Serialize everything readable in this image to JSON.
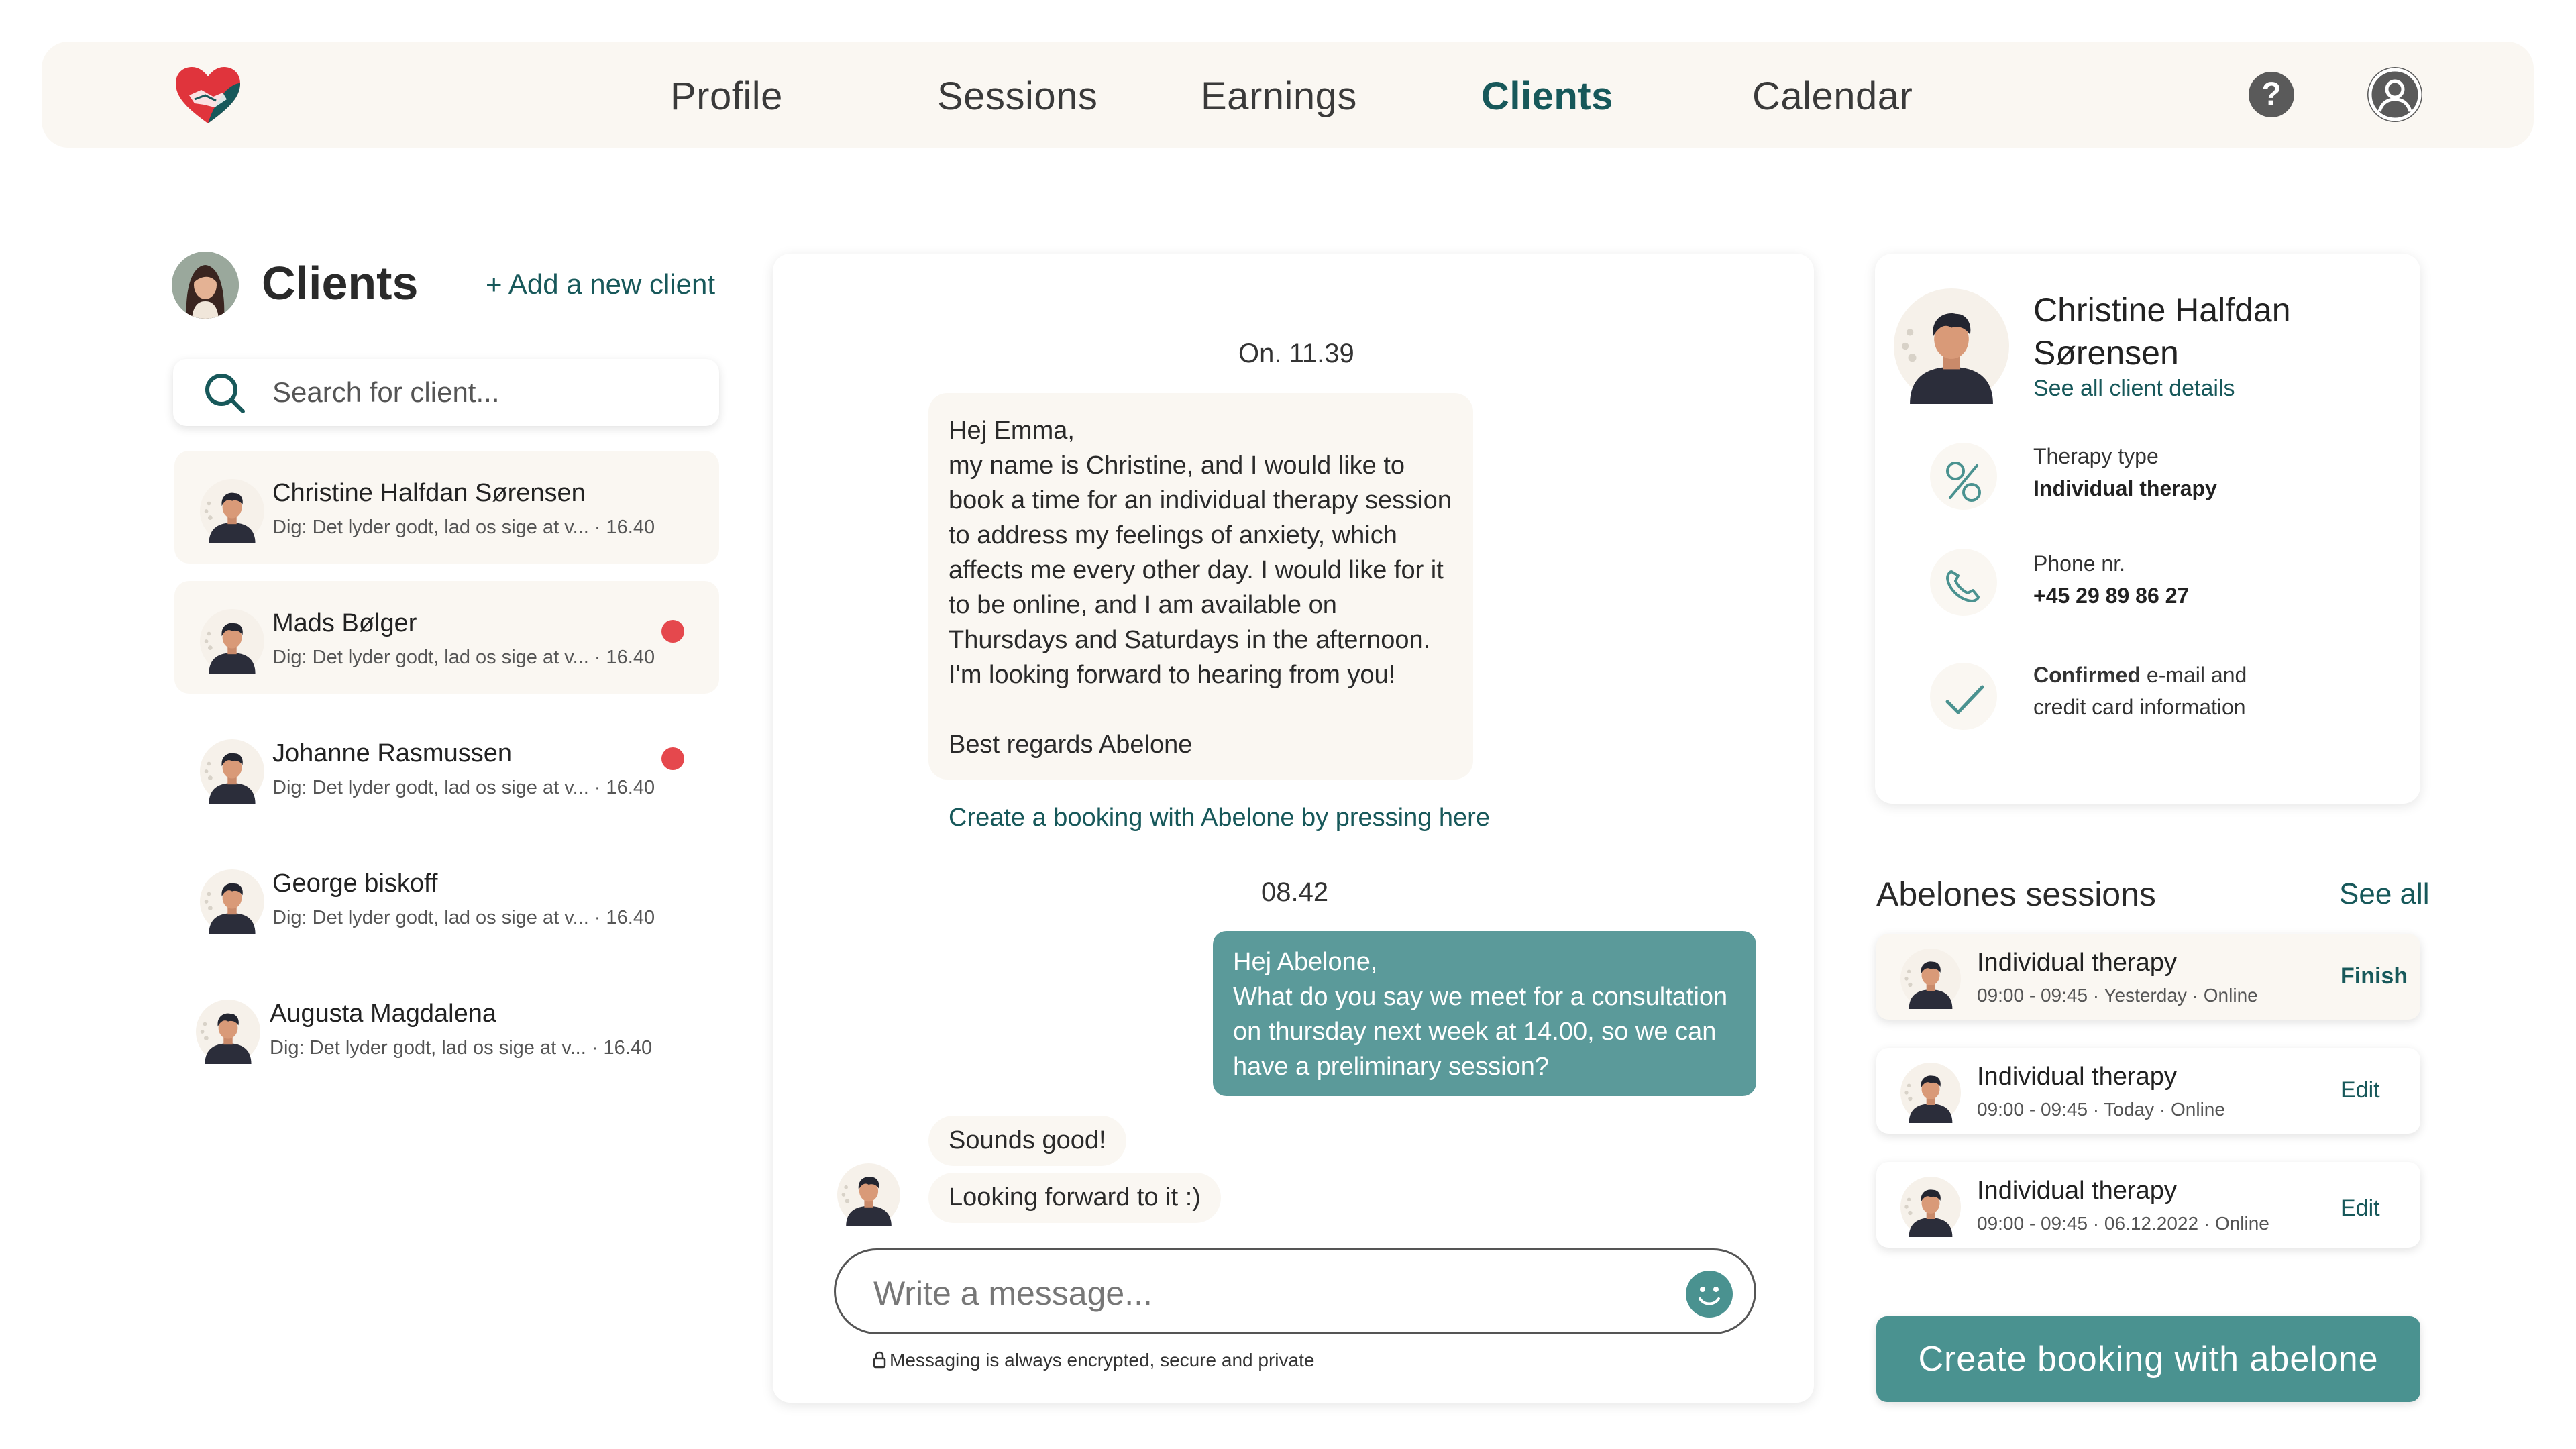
{
  "nav": {
    "logo_icon": "heart-handshake-logo",
    "items": [
      {
        "label": "Profile",
        "active": false
      },
      {
        "label": "Sessions",
        "active": false
      },
      {
        "label": "Earnings",
        "active": false
      },
      {
        "label": "Clients",
        "active": true
      },
      {
        "label": "Calendar",
        "active": false
      }
    ],
    "help_icon_glyph": "?",
    "user_icon": "user-icon"
  },
  "clients_panel": {
    "title": "Clients",
    "add_label": "+ Add a new client",
    "search_placeholder": "Search for client...",
    "clients": [
      {
        "name": "Christine Halfdan Sørensen",
        "preview": "Dig: Det lyder godt, lad os sige at v...",
        "time": "16.40",
        "selected": true,
        "unread": false
      },
      {
        "name": "Mads Bølger",
        "preview": "Dig: Det lyder godt, lad os sige at v...",
        "time": "16.40",
        "selected": false,
        "unread": true
      },
      {
        "name": "Johanne Rasmussen",
        "preview": "Dig: Det lyder godt, lad os sige at v...",
        "time": "16.40",
        "selected": false,
        "unread": true
      },
      {
        "name": "George biskoff",
        "preview": "Dig: Det lyder godt, lad os sige at v...",
        "time": "16.40",
        "selected": false,
        "unread": false
      },
      {
        "name": "Augusta Magdalena",
        "preview": "Dig: Det lyder godt, lad os sige at v...",
        "time": "16.40",
        "selected": false,
        "unread": false
      }
    ]
  },
  "chat": {
    "time_1": "On. 11.39",
    "message_1": {
      "greeting": "Hej Emma,",
      "body": "my name is Christine, and I would like to book a time for an individual therapy session to address my feelings of anxiety, which affects me every other day. I would like for it to be online, and I am available on Thursdays and Saturdays in the afternoon. I'm looking forward to hearing from you!",
      "signoff": "Best regards Abelone"
    },
    "booking_link": "Create a booking with Abelone by pressing here",
    "time_2": "08.42",
    "message_2": {
      "greeting": "Hej Abelone,",
      "body": "What do you say we meet for a consultation on thursday next week at 14.00, so we can have a preliminary session?"
    },
    "reply_1": "Sounds good!",
    "reply_2": "Looking forward to it :)",
    "composer_placeholder": "Write a message...",
    "secure_note": "Messaging is always encrypted, secure and private",
    "secure_icon": "lock-icon"
  },
  "client_card": {
    "name": "Christine Halfdan Sørensen",
    "details_link": "See all client details",
    "therapy_label": "Therapy type",
    "therapy_value": "Individual therapy",
    "phone_label": "Phone nr.",
    "phone_value": "+45 29 89 86 27",
    "confirmed_bold": "Confirmed",
    "confirmed_rest_1": " e-mail and",
    "confirmed_rest_2": "credit card information"
  },
  "sessions": {
    "title": "Abelones sessions",
    "see_all": "See all",
    "items": [
      {
        "title": "Individual therapy",
        "sub": "09:00 - 09:45 · Yesterday · Online",
        "action": "Finish"
      },
      {
        "title": "Individual therapy",
        "sub": "09:00 - 09:45 · Today · Online",
        "action": "Edit"
      },
      {
        "title": "Individual therapy",
        "sub": "09:00 - 09:45 · 06.12.2022 · Online",
        "action": "Edit"
      }
    ]
  },
  "cta_label": "Create booking with abelone",
  "colors": {
    "accent": "#17585a",
    "teal_button": "#4a9290",
    "outgoing_bubble": "#5b9a9a",
    "incoming_bubble": "#faf7f2",
    "unread_dot": "#e5484d",
    "logo_red": "#e0343c",
    "logo_teal": "#17585a"
  }
}
